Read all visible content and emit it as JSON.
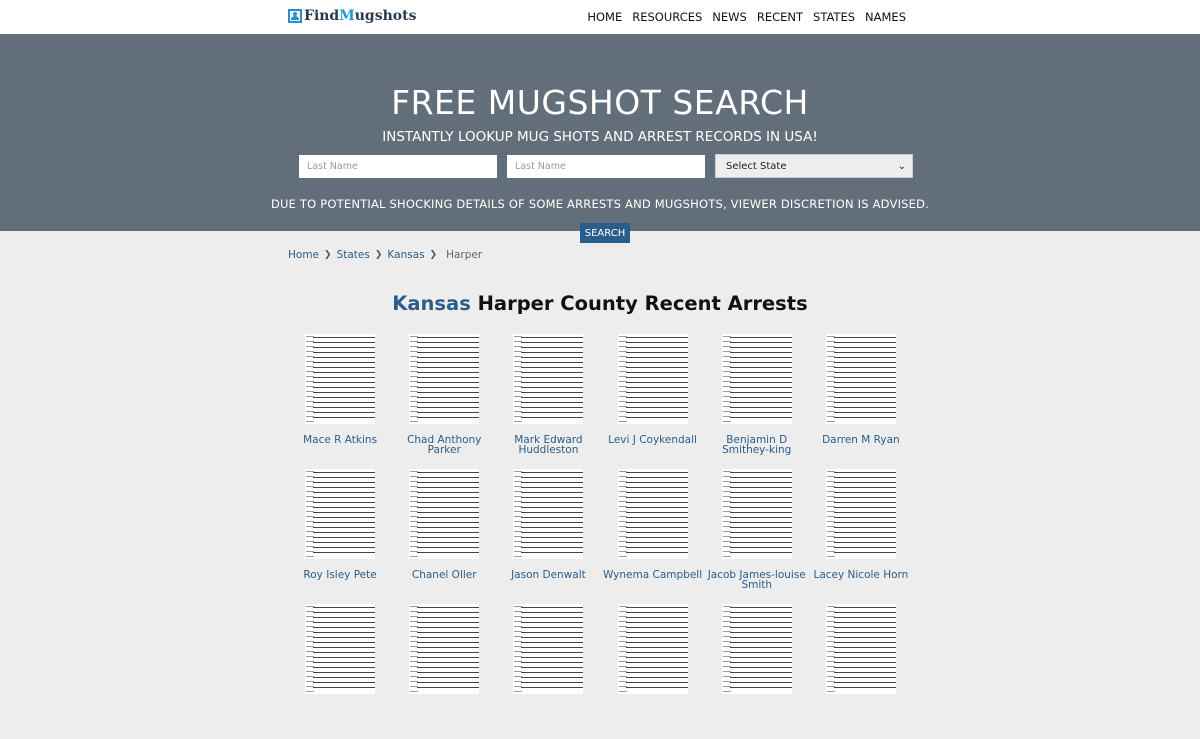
{
  "brand": {
    "prefix": "Find",
    "m": "M",
    "suffix": "ugshots"
  },
  "nav": [
    "HOME",
    "RESOURCES",
    "NEWS",
    "RECENT",
    "STATES",
    "NAMES"
  ],
  "hero": {
    "title": "FREE MUGSHOT SEARCH",
    "subtitle": "INSTANTLY LOOKUP MUG SHOTS AND ARREST RECORDS IN USA!",
    "first_input_placeholder": "Last Name",
    "last_input_placeholder": "Last Name",
    "state_select": "Select State",
    "disclaimer": "DUE TO POTENTIAL SHOCKING DETAILS OF SOME ARRESTS AND MUGSHOTS, VIEWER DISCRETION IS ADVISED.",
    "search_button": "SEARCH"
  },
  "breadcrumb": {
    "home": "Home",
    "states": "States",
    "state": "Kansas",
    "current": "Harper"
  },
  "page_title": {
    "state": "Kansas",
    "rest": "Harper County Recent Arrests"
  },
  "arrests": [
    "Mace R Atkins",
    "Chad Anthony Parker",
    "Mark Edward Huddleston",
    "Levi J Coykendall",
    "Benjamin D Smithey-king",
    "Darren M Ryan",
    "Roy Isley Pete",
    "Chanel Oller",
    "Jason Denwalt",
    "Wynema Campbell",
    "Jacob James-louise Smith",
    "Lacey Nicole Horn"
  ],
  "colors": {
    "hero_bg": "#626e7a",
    "accent": "#2a5d8a",
    "page_bg": "#ededed"
  }
}
